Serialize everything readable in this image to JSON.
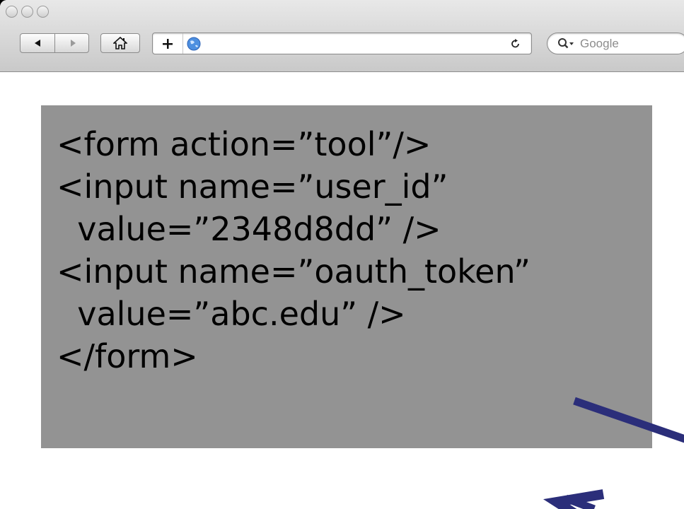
{
  "browser": {
    "search_placeholder": "Google",
    "icons": {
      "back": "back-arrow-icon",
      "forward": "forward-arrow-icon",
      "home": "home-icon",
      "add_bookmark": "plus-icon",
      "site": "globe-icon",
      "reload": "reload-icon",
      "search": "search-icon"
    }
  },
  "code": {
    "lines": [
      "<form action=”tool”/>",
      "<input name=”user_id”",
      "  value=”2348d8dd” />",
      "<input name=”oauth_token”",
      "  value=”abc.edu” />",
      "</form>"
    ]
  },
  "colors": {
    "code_background": "#939393",
    "arrow": "#2b2e7a"
  }
}
